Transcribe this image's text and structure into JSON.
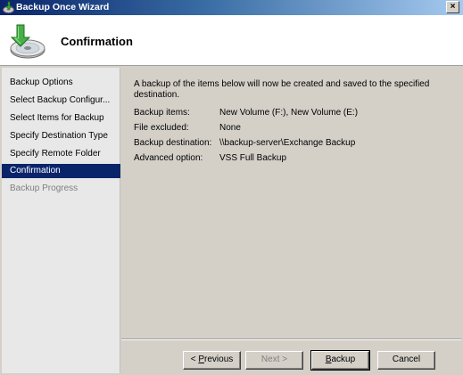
{
  "window": {
    "title": "Backup Once Wizard",
    "close_glyph": "×",
    "icon": "backup-wizard-icon"
  },
  "header": {
    "title": "Confirmation",
    "icon": "backup-disc-icon"
  },
  "nav": {
    "items": [
      {
        "label": "Backup Options",
        "state": "normal"
      },
      {
        "label": "Select Backup Configur...",
        "state": "normal"
      },
      {
        "label": "Select Items for Backup",
        "state": "normal"
      },
      {
        "label": "Specify Destination Type",
        "state": "normal"
      },
      {
        "label": "Specify Remote Folder",
        "state": "normal"
      },
      {
        "label": "Confirmation",
        "state": "active"
      },
      {
        "label": "Backup Progress",
        "state": "disabled"
      }
    ]
  },
  "content": {
    "intro": "A backup of the items below will now be created and saved to the specified destination.",
    "details": [
      {
        "label": "Backup items:",
        "value": "New Volume (F:), New Volume (E:)"
      },
      {
        "label": "File excluded:",
        "value": "None"
      },
      {
        "label": "Backup destination:",
        "value": "\\\\backup-server\\Exchange Backup"
      },
      {
        "label": "Advanced option:",
        "value": "VSS Full Backup"
      }
    ]
  },
  "buttons": {
    "previous": {
      "mnemonic": "P",
      "rest": "revious",
      "prefix": "< "
    },
    "next": {
      "label": "Next >",
      "disabled": true
    },
    "backup": {
      "mnemonic": "B",
      "rest": "ackup"
    },
    "cancel": {
      "label": "Cancel"
    }
  },
  "colors": {
    "selection": "#0a246a",
    "dialog_bg": "#d4d0c8",
    "nav_bg": "#e8e8e8",
    "disabled_text": "#808080"
  }
}
